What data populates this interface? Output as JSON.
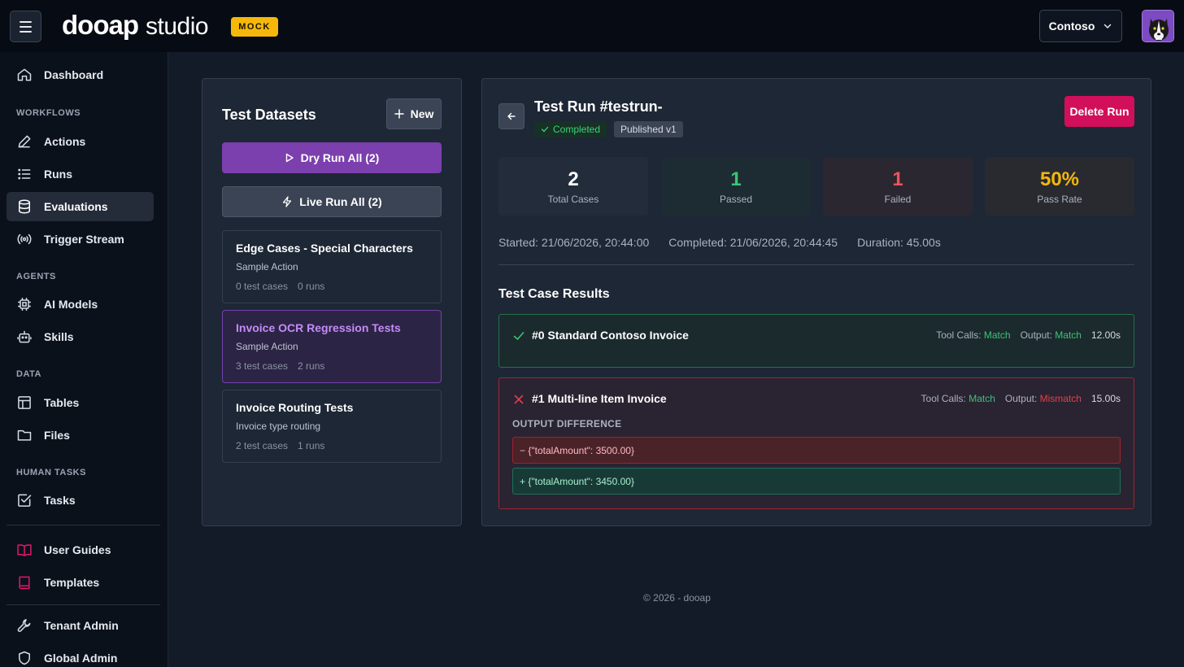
{
  "header": {
    "logo_main": "dooap",
    "logo_sub": "studio",
    "mock_badge": "MOCK",
    "tenant": "Contoso"
  },
  "sidebar": {
    "dashboard": "Dashboard",
    "sections": {
      "workflows": "WORKFLOWS",
      "agents": "AGENTS",
      "data": "DATA",
      "human_tasks": "HUMAN TASKS"
    },
    "items": {
      "actions": "Actions",
      "runs": "Runs",
      "evaluations": "Evaluations",
      "trigger_stream": "Trigger Stream",
      "ai_models": "AI Models",
      "skills": "Skills",
      "tables": "Tables",
      "files": "Files",
      "tasks": "Tasks",
      "user_guides": "User Guides",
      "templates": "Templates",
      "tenant_admin": "Tenant Admin",
      "global_admin": "Global Admin"
    },
    "colors": {
      "accent_pink": "#e0176b"
    }
  },
  "datasets": {
    "title": "Test Datasets",
    "new_label": "New",
    "dry_run_label": "Dry Run All (2)",
    "live_run_label": "Live Run All (2)",
    "items": [
      {
        "name": "Edge Cases - Special Characters",
        "desc": "Sample Action",
        "cases": "0 test cases",
        "runs": "0 runs"
      },
      {
        "name": "Invoice OCR Regression Tests",
        "desc": "Sample Action",
        "cases": "3 test cases",
        "runs": "2 runs"
      },
      {
        "name": "Invoice Routing Tests",
        "desc": "Invoice type routing",
        "cases": "2 test cases",
        "runs": "1 runs"
      }
    ]
  },
  "run": {
    "title": "Test Run #testrun-",
    "status": "Completed",
    "version": "Published v1",
    "delete_label": "Delete Run",
    "stats": {
      "total": {
        "value": "2",
        "label": "Total Cases"
      },
      "passed": {
        "value": "1",
        "label": "Passed"
      },
      "failed": {
        "value": "1",
        "label": "Failed"
      },
      "pass_rate": {
        "value": "50%",
        "label": "Pass Rate"
      }
    },
    "started": "Started: 21/06/2026, 20:44:00",
    "completed": "Completed: 21/06/2026, 20:44:45",
    "duration": "Duration: 45.00s",
    "results_title": "Test Case Results",
    "results": [
      {
        "name": "#0 Standard Contoso Invoice",
        "tool_calls_label": "Tool Calls:",
        "tool_calls": "Match",
        "output_label": "Output:",
        "output": "Match",
        "duration": "12.00s"
      },
      {
        "name": "#1 Multi-line Item Invoice",
        "tool_calls_label": "Tool Calls:",
        "tool_calls": "Match",
        "output_label": "Output:",
        "output": "Mismatch",
        "duration": "15.00s",
        "diff_label": "OUTPUT DIFFERENCE",
        "diff_minus": "− {\"totalAmount\": 3500.00}",
        "diff_plus": "+ {\"totalAmount\": 3450.00}"
      }
    ]
  },
  "footer": "© 2026 - dooap"
}
